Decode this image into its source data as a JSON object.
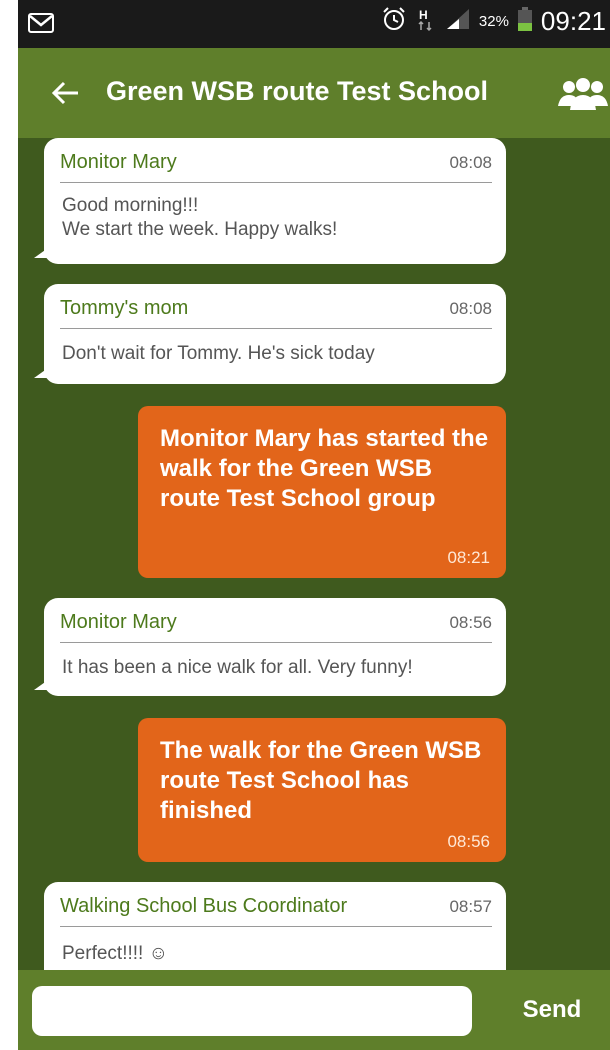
{
  "status_bar": {
    "battery": "32%",
    "time": "09:21",
    "network": "H",
    "icons": [
      "gmail-icon",
      "alarm-icon",
      "network-h-icon",
      "signal-icon",
      "battery-icon"
    ]
  },
  "header": {
    "title": "Green WSB route Test School",
    "back_icon": "arrow-left-icon",
    "group_icon": "group-icon"
  },
  "messages": [
    {
      "sender": "Monitor Mary",
      "time": "08:08",
      "text": "Good morning!!!\nWe start the week. Happy walks!"
    },
    {
      "sender": "Tommy's mom",
      "time": "08:08",
      "text": "Don't wait for Tommy. He's sick today"
    },
    {
      "system": true,
      "time": "08:21",
      "text": "Monitor Mary has started the walk for the Green WSB route Test School group"
    },
    {
      "sender": "Monitor Mary",
      "time": "08:56",
      "text": "It has been a nice walk for all. Very funny!"
    },
    {
      "system": true,
      "time": "08:56",
      "text": "The walk for the Green WSB route Test School has finished"
    },
    {
      "sender": "Walking School Bus Coordinator",
      "time": "08:57",
      "text": "Perfect!!!! ☺"
    }
  ],
  "composer": {
    "value": "",
    "placeholder": "",
    "send_label": "Send"
  },
  "colors": {
    "header_bg": "#5f7f2b",
    "chat_bg": "#3f5a1e",
    "system_bubble": "#e2651a",
    "sender_name": "#4d7a1c"
  }
}
